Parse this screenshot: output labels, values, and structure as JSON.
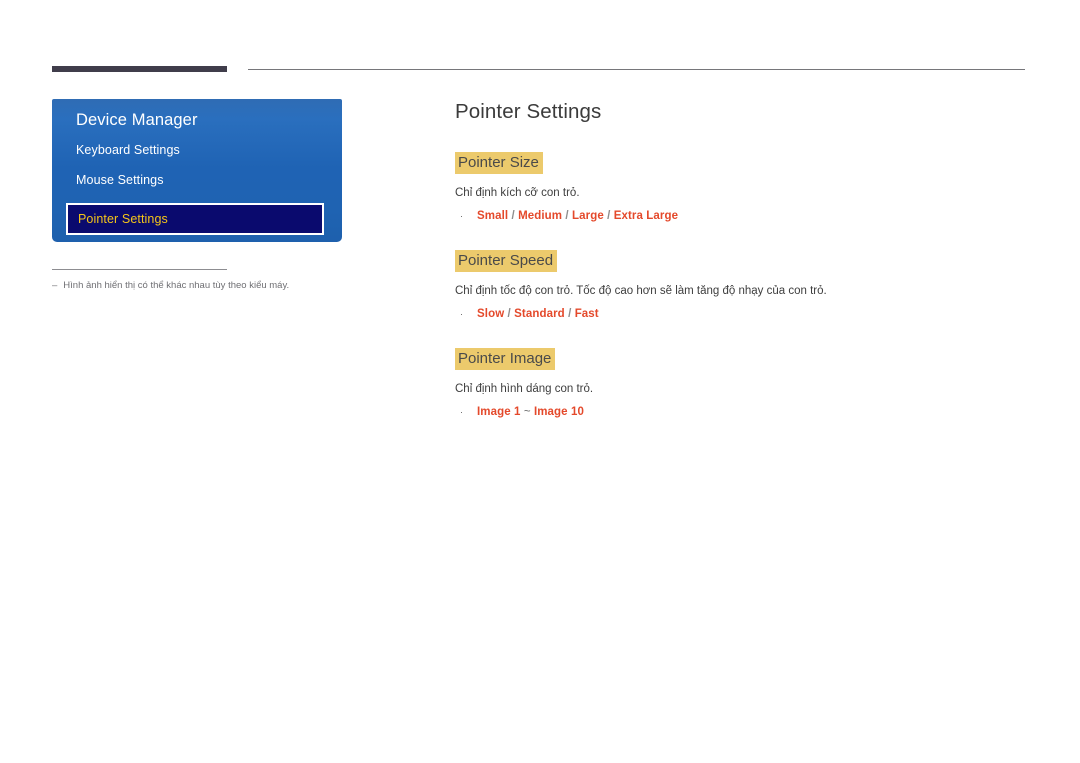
{
  "page": {
    "title": "Pointer Settings"
  },
  "osd": {
    "title": "Device Manager",
    "items": [
      {
        "label": "Keyboard Settings",
        "selected": false
      },
      {
        "label": "Mouse Settings",
        "selected": false
      },
      {
        "label": "Pointer Settings",
        "selected": true
      }
    ]
  },
  "note": {
    "dash": "–",
    "text": "Hình ảnh hiển thị có thể khác nhau tùy theo kiểu máy."
  },
  "sections": [
    {
      "heading": "Pointer Size",
      "description": "Chỉ định kích cỡ con trỏ.",
      "bullet": "·",
      "options": [
        "Small",
        "Medium",
        "Large",
        "Extra Large"
      ],
      "separator": "/"
    },
    {
      "heading": "Pointer Speed",
      "description": "Chỉ định tốc độ con trỏ. Tốc độ cao hơn sẽ làm tăng độ nhạy của con trỏ.",
      "bullet": "·",
      "options": [
        "Slow",
        "Standard",
        "Fast"
      ],
      "separator": "/"
    },
    {
      "heading": "Pointer Image",
      "description": "Chỉ định hình dáng con trỏ.",
      "bullet": "·",
      "options": [
        "Image 1",
        "Image 10"
      ],
      "separator": "~"
    }
  ],
  "colors": {
    "osd_panel_blue": "#1f63b4",
    "osd_selected_bg": "#0a0a6e",
    "osd_selected_text": "#f5c518",
    "heading_highlight": "#ecca6c",
    "option_text": "#e4492b",
    "rule_dark": "#403d4b"
  }
}
